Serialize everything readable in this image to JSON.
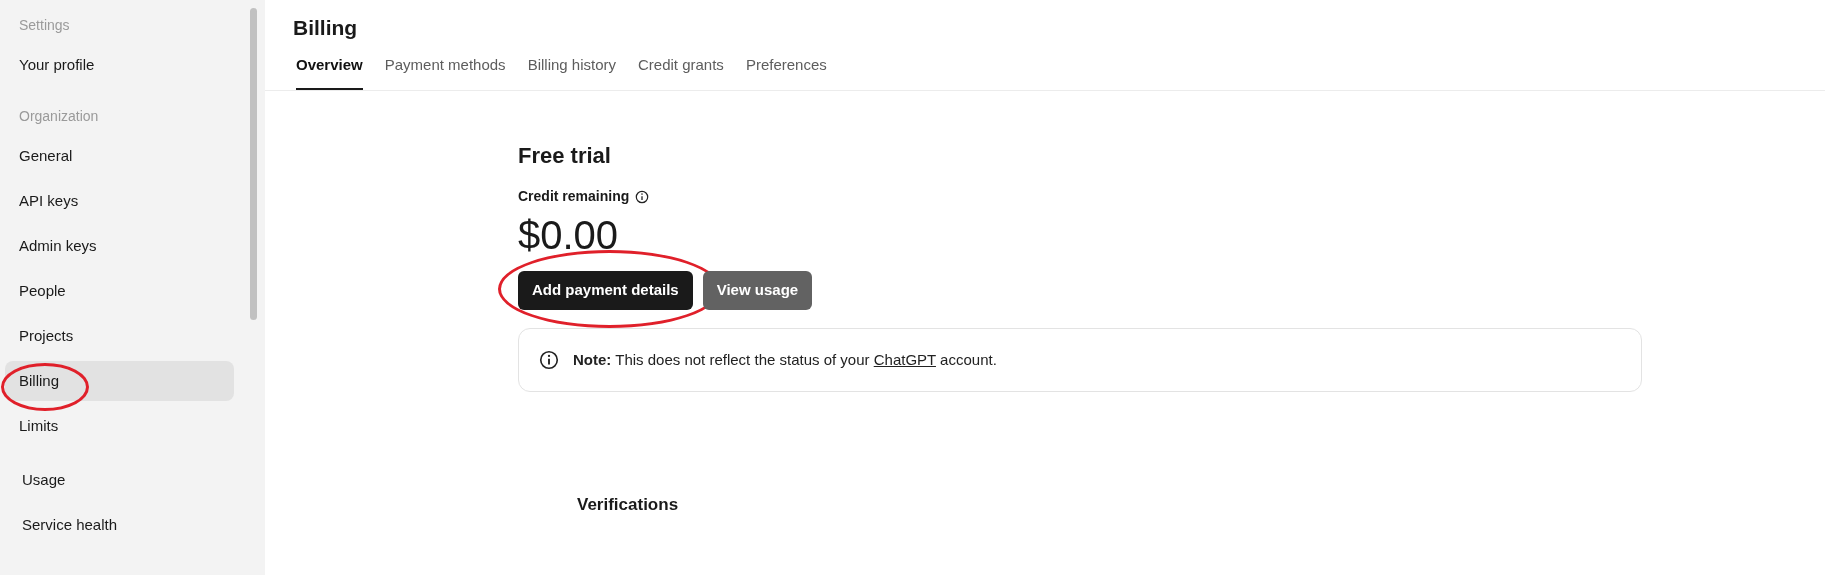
{
  "sidebar": {
    "sections": [
      {
        "heading": "Settings",
        "items": [
          {
            "label": "Your profile",
            "selected": false,
            "circled": false
          }
        ]
      },
      {
        "heading": "Organization",
        "items": [
          {
            "label": "General",
            "selected": false,
            "circled": false
          },
          {
            "label": "API keys",
            "selected": false,
            "circled": false
          },
          {
            "label": "Admin keys",
            "selected": false,
            "circled": false
          },
          {
            "label": "People",
            "selected": false,
            "circled": false
          },
          {
            "label": "Projects",
            "selected": false,
            "circled": false
          },
          {
            "label": "Billing",
            "selected": true,
            "circled": true
          },
          {
            "label": "Limits",
            "selected": false,
            "circled": false
          }
        ]
      },
      {
        "items": [
          {
            "label": "Usage",
            "selected": false,
            "circled": false
          },
          {
            "label": "Service health",
            "selected": false,
            "circled": false
          }
        ]
      }
    ]
  },
  "page": {
    "title": "Billing",
    "tabs": [
      {
        "label": "Overview",
        "selected": true
      },
      {
        "label": "Payment methods",
        "selected": false
      },
      {
        "label": "Billing history",
        "selected": false
      },
      {
        "label": "Credit grants",
        "selected": false
      },
      {
        "label": "Preferences",
        "selected": false
      }
    ],
    "plan": "Free trial",
    "credit_label": "Credit remaining",
    "credit": "$0.00",
    "buttons": [
      {
        "label": "Add payment details",
        "kind": "primary",
        "circled": true
      },
      {
        "label": "View usage",
        "kind": "secondary",
        "circled": false
      }
    ],
    "note": {
      "text_before": "**Note:** This does not reflect the status of your ",
      "link": "ChatGPT",
      "text_after": " account."
    },
    "section_heading": "Verifications"
  }
}
